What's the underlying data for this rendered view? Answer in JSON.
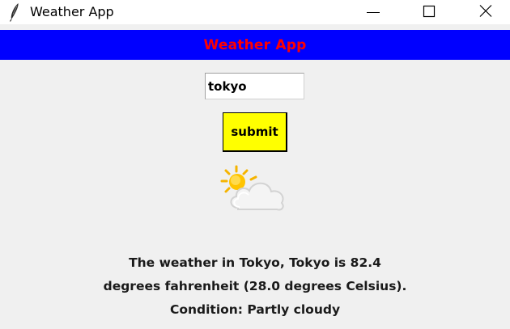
{
  "window": {
    "title": "Weather App",
    "icon": "feather-icon",
    "controls": [
      "minimize-icon",
      "maximize-icon",
      "close-icon"
    ]
  },
  "header": {
    "title": "Weather App",
    "background_color": "#0000ff",
    "text_color": "#ff0000"
  },
  "search": {
    "value": "tokyo"
  },
  "submit": {
    "label": "submit",
    "background_color": "#ffff00"
  },
  "weather_icon": {
    "name": "partly-cloudy-icon"
  },
  "result": {
    "lines": [
      "The weather in Tokyo, Tokyo is 82.4",
      "degrees fahrenheit (28.0 degrees Celsius).",
      "Condition: Partly cloudy"
    ]
  }
}
